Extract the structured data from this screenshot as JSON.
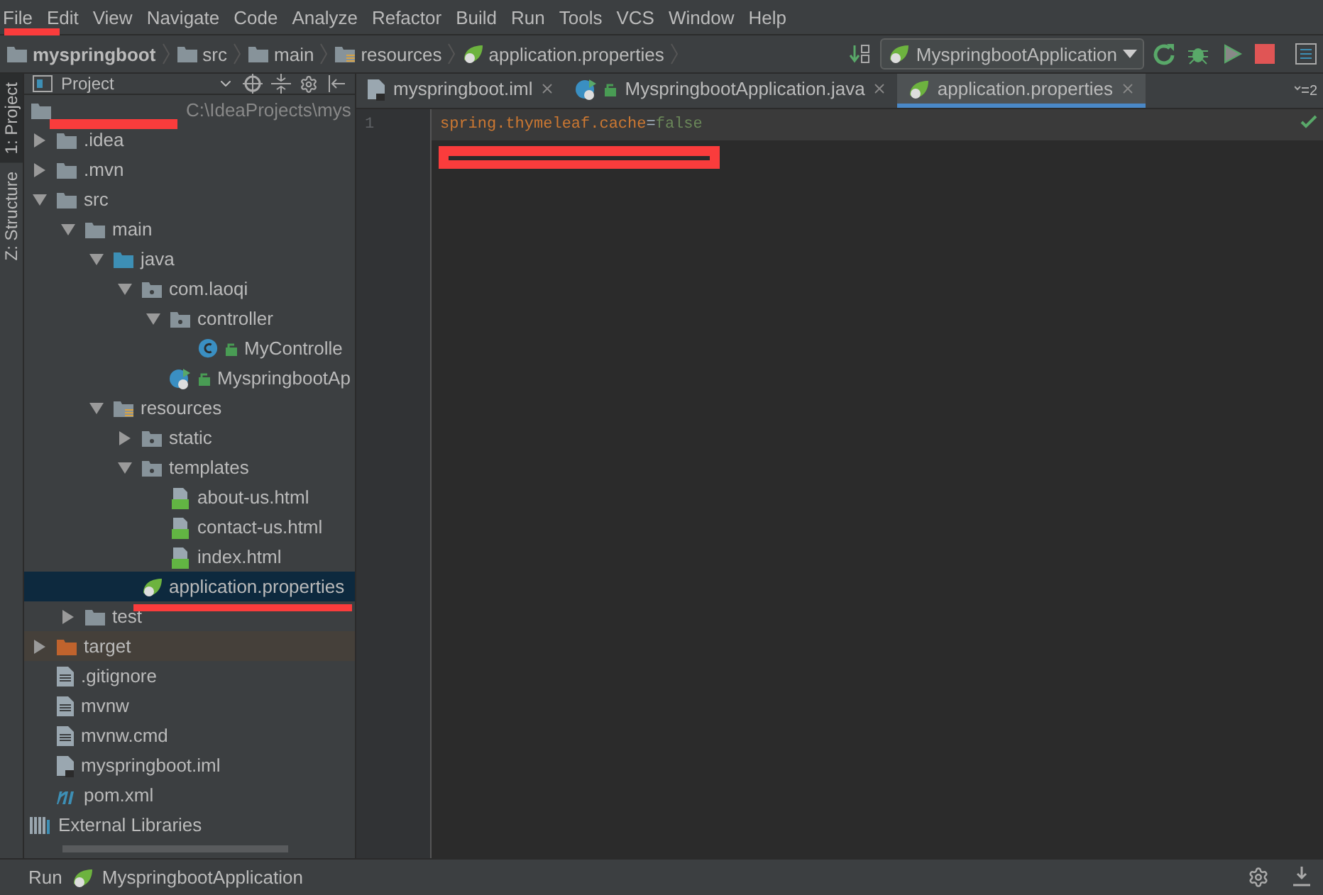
{
  "menu": [
    {
      "label": "File"
    },
    {
      "label": "Edit"
    },
    {
      "label": "View"
    },
    {
      "label": "Navigate"
    },
    {
      "label": "Code"
    },
    {
      "label": "Analyze"
    },
    {
      "label": "Refactor"
    },
    {
      "label": "Build"
    },
    {
      "label": "Run"
    },
    {
      "label": "Tools"
    },
    {
      "label": "VCS"
    },
    {
      "label": "Window"
    },
    {
      "label": "Help"
    }
  ],
  "breadcrumbs": [
    {
      "label": "myspringboot",
      "kind": "module"
    },
    {
      "label": "src",
      "kind": "folder"
    },
    {
      "label": "main",
      "kind": "folder"
    },
    {
      "label": "resources",
      "kind": "resources"
    },
    {
      "label": "application.properties",
      "kind": "spring"
    }
  ],
  "run_config": {
    "label": "MyspringbootApplication"
  },
  "side_tabs": [
    {
      "label": "1: Project",
      "selected": true
    },
    {
      "label": "Z: Structure",
      "selected": false
    }
  ],
  "project_panel": {
    "title": "Project"
  },
  "project_tree": [
    {
      "kind": "project",
      "path": "C:\\IdeaProjects\\mys",
      "expanded": true,
      "selected": false,
      "children": [
        {
          "kind": "folder",
          "label": ".idea",
          "expanded": false,
          "selected": false
        },
        {
          "kind": "folder",
          "label": ".mvn",
          "expanded": false,
          "selected": false
        },
        {
          "kind": "folder",
          "label": "src",
          "expanded": true,
          "selected": false,
          "children": [
            {
              "kind": "folder",
              "label": "main",
              "expanded": true,
              "selected": false,
              "children": [
                {
                  "kind": "source",
                  "label": "java",
                  "expanded": true,
                  "selected": false,
                  "children": [
                    {
                      "kind": "package",
                      "label": "com.laoqi",
                      "expanded": true,
                      "selected": false,
                      "children": [
                        {
                          "kind": "package",
                          "label": "controller",
                          "expanded": true,
                          "selected": false,
                          "children": [
                            {
                              "kind": "class",
                              "label": "MyControlle",
                              "selected": false
                            }
                          ]
                        },
                        {
                          "kind": "spring-class",
                          "label": "MyspringbootAp",
                          "selected": false
                        }
                      ]
                    }
                  ]
                },
                {
                  "kind": "resources",
                  "label": "resources",
                  "expanded": true,
                  "selected": false,
                  "children": [
                    {
                      "kind": "package",
                      "label": "static",
                      "expanded": false,
                      "selected": false
                    },
                    {
                      "kind": "package",
                      "label": "templates",
                      "expanded": true,
                      "selected": false,
                      "children": [
                        {
                          "kind": "html",
                          "label": "about-us.html",
                          "selected": false
                        },
                        {
                          "kind": "html",
                          "label": "contact-us.html",
                          "selected": false
                        },
                        {
                          "kind": "html",
                          "label": "index.html",
                          "selected": false
                        }
                      ]
                    },
                    {
                      "kind": "spring",
                      "label": "application.properties",
                      "selected": true
                    }
                  ]
                }
              ]
            },
            {
              "kind": "folder",
              "label": "test",
              "expanded": false,
              "selected": false
            }
          ]
        },
        {
          "kind": "excluded",
          "label": "target",
          "expanded": false,
          "selected": false
        },
        {
          "kind": "file",
          "label": ".gitignore",
          "selected": false
        },
        {
          "kind": "file",
          "label": "mvnw",
          "selected": false
        },
        {
          "kind": "file",
          "label": "mvnw.cmd",
          "selected": false
        },
        {
          "kind": "iml",
          "label": "myspringboot.iml",
          "selected": false
        },
        {
          "kind": "maven",
          "label": "pom.xml",
          "selected": false
        }
      ]
    },
    {
      "kind": "libraries",
      "label": "External Libraries",
      "selected": false
    }
  ],
  "editor_tabs": [
    {
      "label": "myspringboot.iml",
      "kind": "iml",
      "selected": false
    },
    {
      "label": "MyspringbootApplication.java",
      "kind": "spring-class",
      "selected": false
    },
    {
      "label": "application.properties",
      "kind": "spring",
      "selected": true
    }
  ],
  "tab_count": "2",
  "editor_lines": [
    {
      "number": "1",
      "key": "spring.thymeleaf.cache",
      "separator": "=",
      "value": "false",
      "current": true
    }
  ],
  "status_bar": {
    "label": "Run",
    "config": "MyspringbootApplication"
  }
}
